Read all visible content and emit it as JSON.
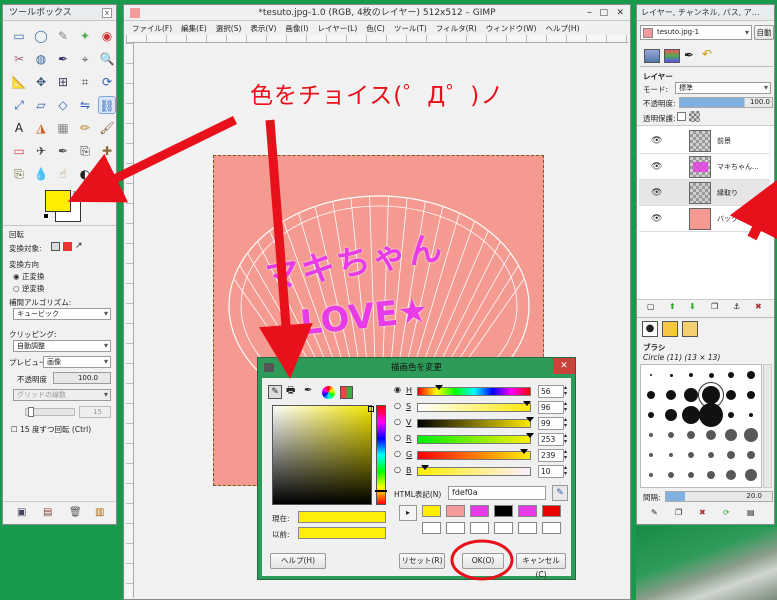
{
  "toolbox": {
    "title": "ツールボックス",
    "close": "x",
    "options_title": "回転",
    "transform_label": "変換対象:",
    "direction_label": "変換方向",
    "direction_normal": "正変換",
    "direction_reverse": "逆変換",
    "interp_label": "補間アルゴリズム:",
    "interp_value": "キュービック",
    "clipping_label": "クリッピング:",
    "clipping_value": "自動調整",
    "preview_label": "プレビュー:",
    "preview_value": "画像",
    "opacity_label": "不透明度",
    "opacity_value": "100.0",
    "guides_value": "グリッドの線数",
    "guides_num": "15",
    "rotate15_label": "15 度ずつ回転 (Ctrl)"
  },
  "annotation": {
    "text": "色をチョイス(゜Д゜)ノ"
  },
  "main_window": {
    "title": "*tesuto.jpg-1.0 (RGB, 4枚のレイヤー) 512x512 – GIMP",
    "menu": [
      "ファイル(F)",
      "編集(E)",
      "選択(S)",
      "表示(V)",
      "画像(I)",
      "レイヤー(L)",
      "色(C)",
      "ツール(T)",
      "フィルタ(R)",
      "ウィンドウ(W)",
      "ヘルプ(H)"
    ],
    "canvas_text_1": "マキちゃん",
    "canvas_text_2": "LOVE★"
  },
  "dialog": {
    "title": "描画色を変更",
    "channels": [
      {
        "key": "H",
        "value": "56",
        "checked": true,
        "pos": 0.16
      },
      {
        "key": "S",
        "value": "96",
        "checked": false,
        "pos": 0.96
      },
      {
        "key": "V",
        "value": "99",
        "checked": false,
        "pos": 0.99
      },
      {
        "key": "R",
        "value": "253",
        "checked": false,
        "pos": 0.99
      },
      {
        "key": "G",
        "value": "239",
        "checked": false,
        "pos": 0.94
      },
      {
        "key": "B",
        "value": "10",
        "checked": false,
        "pos": 0.04
      }
    ],
    "hex_label": "HTML表記(N)",
    "hex_value": "fdef0a",
    "current_label": "現在:",
    "previous_label": "以前:",
    "help_button": "ヘルプ(H)",
    "reset_button": "リセット(R)",
    "ok_button": "OK(O)",
    "cancel_button": "キャンセル(C)",
    "history_colors": [
      "#ffee00",
      "#f49a9a",
      "#e83be8",
      "#000000",
      "#e83be8",
      "#e80000"
    ],
    "current_color": "#fdef0a"
  },
  "layers_panel": {
    "title": "レイヤー, チャンネル, パス, ア...",
    "image_selector": "tesuto.jpg-1",
    "auto_button": "自動",
    "tab_label": "レイヤー",
    "mode_label": "モード:",
    "mode_value": "標準",
    "opacity_label": "不透明度:",
    "opacity_value": "100.0",
    "lock_label": "透明保護:",
    "layers": [
      {
        "name": "前景",
        "thumb": "checker"
      },
      {
        "name": "マキちゃん...",
        "thumb": "pink-text"
      },
      {
        "name": "縁取り",
        "thumb": "checker"
      },
      {
        "name": "バック",
        "thumb": "pink"
      }
    ],
    "brushes_label": "ブラシ",
    "brush_name": "Circle (11) (13 × 13)",
    "spacing_label": "間隔:",
    "spacing_value": "20.0"
  },
  "colors": {
    "fg": "#ffee00",
    "canvas_bg": "#f49a90",
    "pink_text": "#e83be8",
    "arrow_red": "#e8101a",
    "dialog_border": "#2e8b57"
  }
}
